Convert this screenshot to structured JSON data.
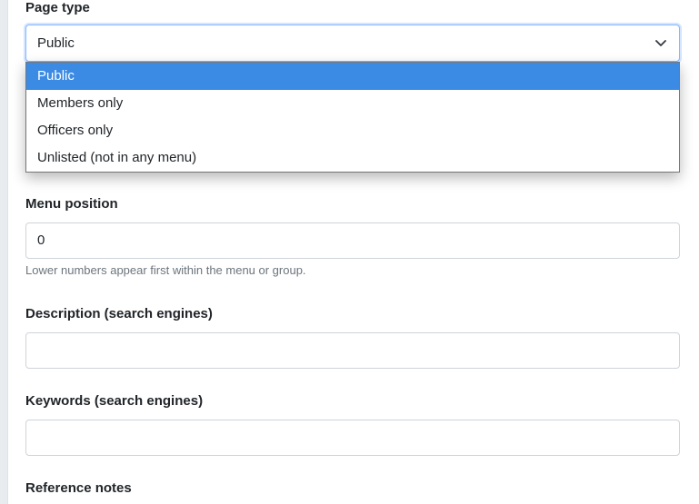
{
  "form": {
    "page_type": {
      "label": "Page type",
      "selected": "Public",
      "options": [
        "Public",
        "Members only",
        "Officers only",
        "Unlisted (not in any menu)"
      ],
      "highlighted_index": 0
    },
    "menu_position": {
      "label": "Menu position",
      "value": "0",
      "hint": "Lower numbers appear first within the menu or group."
    },
    "description": {
      "label": "Description (search engines)",
      "value": ""
    },
    "keywords": {
      "label": "Keywords (search engines)",
      "value": ""
    },
    "reference_notes": {
      "label": "Reference notes"
    }
  },
  "icons": {
    "select_arrow": "chevron-down-icon"
  },
  "colors": {
    "highlight": "#3b8be4",
    "focus_border": "#86b7fe",
    "hint_text": "#6c757d"
  }
}
